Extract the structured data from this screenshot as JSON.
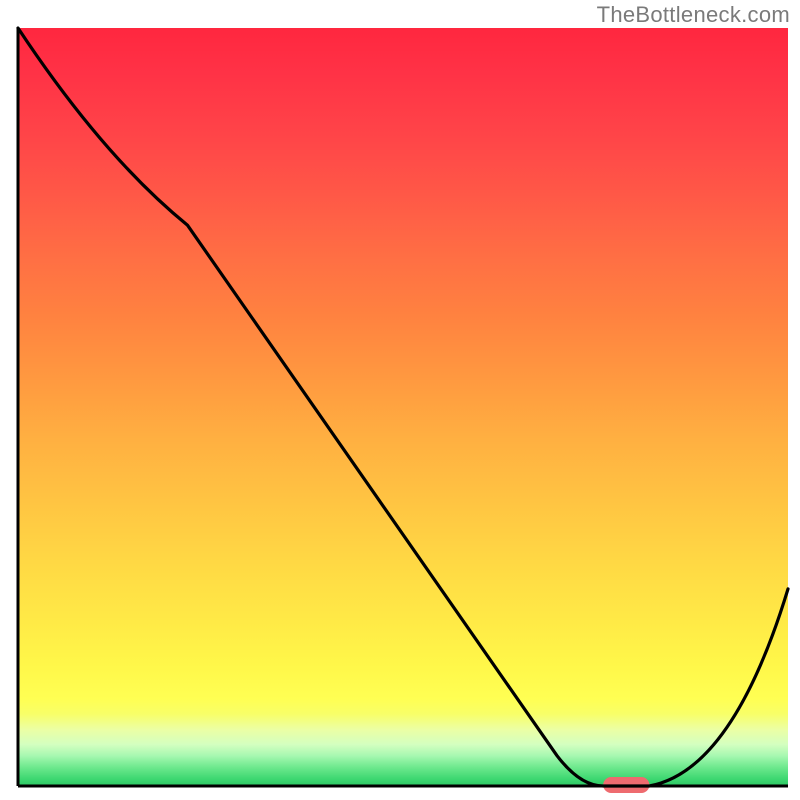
{
  "watermark": "TheBottleneck.com",
  "chart_data": {
    "type": "line",
    "title": "",
    "xlabel": "",
    "ylabel": "",
    "xlim": [
      0,
      100
    ],
    "ylim": [
      0,
      100
    ],
    "x": [
      0,
      22,
      70,
      76,
      82,
      100
    ],
    "values": [
      100,
      74,
      4,
      0,
      0,
      26
    ],
    "marker": {
      "x_start": 76,
      "x_end": 82,
      "y": 0,
      "color": "#ee6b6f"
    },
    "background_gradient": {
      "stops": [
        {
          "offset": 0.0,
          "color": "#ff273f"
        },
        {
          "offset": 0.06,
          "color": "#ff3246"
        },
        {
          "offset": 0.14,
          "color": "#ff4448"
        },
        {
          "offset": 0.22,
          "color": "#ff5847"
        },
        {
          "offset": 0.3,
          "color": "#ff6e44"
        },
        {
          "offset": 0.38,
          "color": "#ff8240"
        },
        {
          "offset": 0.46,
          "color": "#ff9840"
        },
        {
          "offset": 0.54,
          "color": "#ffaf41"
        },
        {
          "offset": 0.62,
          "color": "#ffc342"
        },
        {
          "offset": 0.7,
          "color": "#ffd744"
        },
        {
          "offset": 0.78,
          "color": "#ffe946"
        },
        {
          "offset": 0.84,
          "color": "#fff749"
        },
        {
          "offset": 0.885,
          "color": "#ffff53"
        },
        {
          "offset": 0.905,
          "color": "#f8ff68"
        },
        {
          "offset": 0.925,
          "color": "#ecffa3"
        },
        {
          "offset": 0.945,
          "color": "#d4ffc0"
        },
        {
          "offset": 0.96,
          "color": "#a7f8b1"
        },
        {
          "offset": 0.975,
          "color": "#6fe98e"
        },
        {
          "offset": 0.99,
          "color": "#3fd872"
        },
        {
          "offset": 1.0,
          "color": "#2cc764"
        }
      ]
    },
    "curve_color": "#000000",
    "axis_color": "#000000"
  }
}
